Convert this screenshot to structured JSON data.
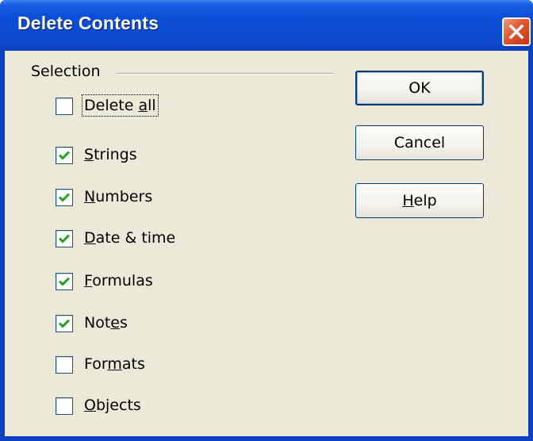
{
  "window": {
    "title": "Delete Contents"
  },
  "selection": {
    "group_label": "Selection",
    "options": [
      {
        "label": "Delete all",
        "mnemonic_before": "Delete ",
        "mnemonic_char": "a",
        "mnemonic_after": "ll",
        "checked": false
      },
      {
        "label": "Strings",
        "mnemonic_before": "",
        "mnemonic_char": "S",
        "mnemonic_after": "trings",
        "checked": true
      },
      {
        "label": "Numbers",
        "mnemonic_before": "",
        "mnemonic_char": "N",
        "mnemonic_after": "umbers",
        "checked": true
      },
      {
        "label": "Date & time",
        "mnemonic_before": "",
        "mnemonic_char": "D",
        "mnemonic_after": "ate & time",
        "checked": true
      },
      {
        "label": "Formulas",
        "mnemonic_before": "",
        "mnemonic_char": "F",
        "mnemonic_after": "ormulas",
        "checked": true
      },
      {
        "label": "Notes",
        "mnemonic_before": "Not",
        "mnemonic_char": "e",
        "mnemonic_after": "s",
        "checked": true
      },
      {
        "label": "Formats",
        "mnemonic_before": "For",
        "mnemonic_char": "m",
        "mnemonic_after": "ats",
        "checked": false
      },
      {
        "label": "Objects",
        "mnemonic_before": "",
        "mnemonic_char": "O",
        "mnemonic_after": "bjects",
        "checked": false
      }
    ]
  },
  "buttons": {
    "ok": "OK",
    "cancel": "Cancel",
    "help_before": "",
    "help_mnemonic": "H",
    "help_after": "elp"
  },
  "colors": {
    "titlebar": "#0a4ad0",
    "dialog_face": "#ece9d8",
    "close_button": "#e0552e"
  },
  "icons": {
    "close": "close-icon",
    "check": "checkmark-icon"
  }
}
